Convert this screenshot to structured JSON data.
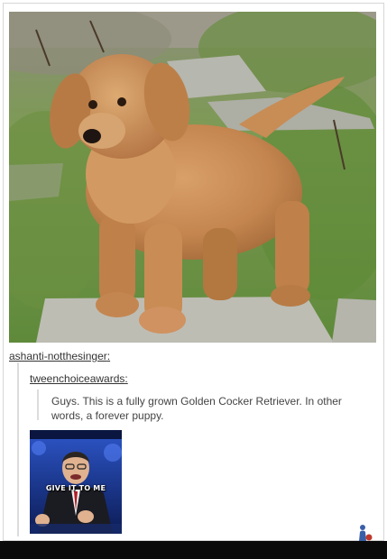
{
  "post": {
    "image_alt": "golden cocker retriever puppy standing on stone path",
    "reblog_user_1": "ashanti-notthesinger",
    "reblog_user_2": "tweenchoiceawards",
    "colon": ":",
    "comment": "Guys. This is a  fully grown Golden Cocker Retriever. In other words, a forever puppy.",
    "gif_caption": "GIVE IT TO ME"
  },
  "icons": {
    "widget": "person-icon"
  },
  "colors": {
    "link_text": "#333333",
    "body_text": "#444444",
    "quote_border": "#dcdcdc",
    "bottom_bar": "#0a0a0a"
  }
}
